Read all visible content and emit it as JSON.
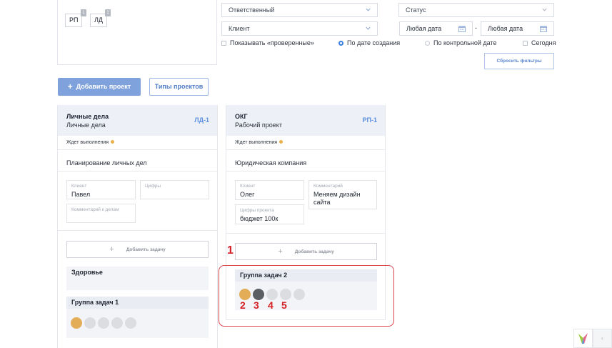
{
  "codes": {
    "items": [
      {
        "label": "РП",
        "count": "1"
      },
      {
        "label": "ЛД",
        "count": "1"
      }
    ]
  },
  "filters": {
    "responsible": "Ответственный",
    "status": "Статус",
    "client": "Клиент",
    "date_from": "Любая дата",
    "date_sep": "-",
    "date_to": "Любая дата",
    "show_checked": "Показывать «проверенные»",
    "by_creation": "По дате создания",
    "by_control": "По контрольной дате",
    "today": "Сегодня",
    "reset": "Сбросить фильтры"
  },
  "actions": {
    "add_project": "Добавить проект",
    "add_project_icon": "+",
    "project_types": "Типы проектов"
  },
  "cards": [
    {
      "title": "Личные дела",
      "subtitle": "Личные дела",
      "code": "ЛД-1",
      "status": "Ждет выполнения",
      "name": "Планирование личных дел",
      "fields": {
        "client_label": "Клиент",
        "client_value": "Павел",
        "numbers_label": "Цифры",
        "comment_label": "Комментарий к делам"
      },
      "add_task": "Добавить задачу",
      "add_task_icon": "+",
      "groups": [
        {
          "title": "Здоровье"
        },
        {
          "title": "Группа задач 1"
        }
      ]
    },
    {
      "title": "ОКГ",
      "subtitle": "Рабочий проект",
      "code": "РП-1",
      "status": "Ждет выполнения",
      "name": "Юридическая компания",
      "fields": {
        "client_label": "Клиент",
        "client_value": "Олег",
        "comment_label": "Комментарий",
        "comment_value": "Меняем дизайн сайта",
        "numbers_label": "Цифры проекта",
        "numbers_value": "бюджет 100к"
      },
      "add_task": "Добавить задачу",
      "add_task_icon": "+",
      "groups": [
        {
          "title": "Группа задач 2"
        }
      ]
    }
  ],
  "annotations": {
    "n1": "1",
    "n2": "2",
    "n3": "3",
    "n4": "4",
    "n5": "5"
  },
  "side": {
    "collapse": "‹"
  },
  "colors": {
    "accent": "#7fa2dc",
    "link": "#5b8fe0",
    "status_dot": "#e9b14c",
    "annotation_red": "#d51f25",
    "task_yellow": "#e3ad58",
    "task_dark": "#5b5e63",
    "task_empty": "#dcdde0"
  }
}
